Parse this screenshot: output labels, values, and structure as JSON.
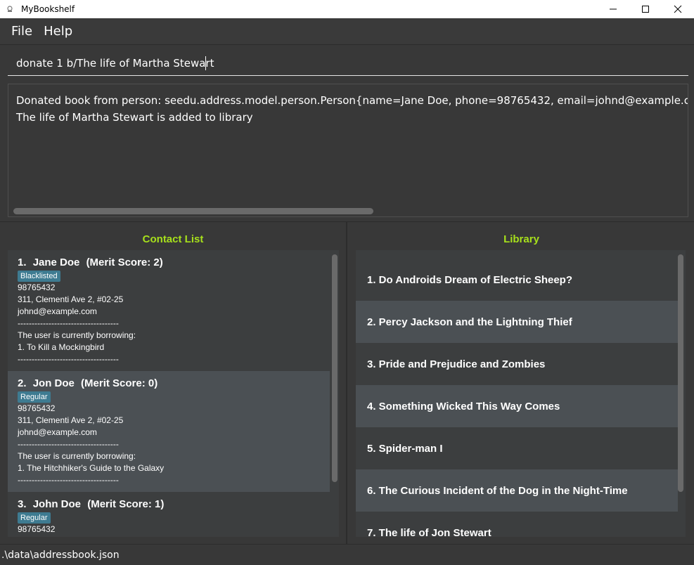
{
  "window": {
    "title": "MyBookshelf"
  },
  "menu": {
    "items": [
      "File",
      "Help"
    ]
  },
  "command": {
    "value": "donate 1 b/The life of Martha Stewart"
  },
  "result": {
    "lines": [
      "Donated book from person: seedu.address.model.person.Person{name=Jane Doe, phone=98765432, email=johnd@example.com, a",
      "The life of Martha Stewart is added to library"
    ]
  },
  "contacts": {
    "title": "Contact List",
    "items": [
      {
        "index": "1.",
        "name": "Jane Doe",
        "merit": "(Merit Score: 2)",
        "tag": "Blacklisted",
        "phone": "98765432",
        "address": "311, Clementi Ave 2, #02-25",
        "email": "johnd@example.com",
        "sep": "------------------------------------",
        "borrow_label": "The user is currently borrowing:",
        "borrowed": "1. To Kill a Mockingbird",
        "sep2": "------------------------------------"
      },
      {
        "index": "2.",
        "name": "Jon Doe",
        "merit": "(Merit Score: 0)",
        "tag": "Regular",
        "phone": "98765432",
        "address": "311, Clementi Ave 2, #02-25",
        "email": "johnd@example.com",
        "sep": "------------------------------------",
        "borrow_label": "The user is currently borrowing:",
        "borrowed": "1. The Hitchhiker's Guide to the Galaxy",
        "sep2": "------------------------------------"
      },
      {
        "index": "3.",
        "name": "John Doe",
        "merit": "(Merit Score: 1)",
        "tag": "Regular",
        "phone": "98765432"
      }
    ]
  },
  "library": {
    "title": "Library",
    "books": [
      "1. Do Androids Dream of Electric Sheep?",
      "2. Percy Jackson and the Lightning Thief",
      "3. Pride and Prejudice and Zombies",
      "4. Something Wicked This Way Comes",
      "5. Spider-man I",
      "6. The Curious Incident of the Dog in the Night-Time",
      "7. The life of Jon Stewart"
    ]
  },
  "status": {
    "path": ".\\data\\addressbook.json"
  },
  "colors": {
    "accent": "#a7e01b",
    "tag": "#3e7b91",
    "background": "#383838"
  },
  "icons": {
    "app": "app-icon",
    "minimize": "minimize-icon",
    "maximize": "maximize-icon",
    "close": "close-icon"
  }
}
